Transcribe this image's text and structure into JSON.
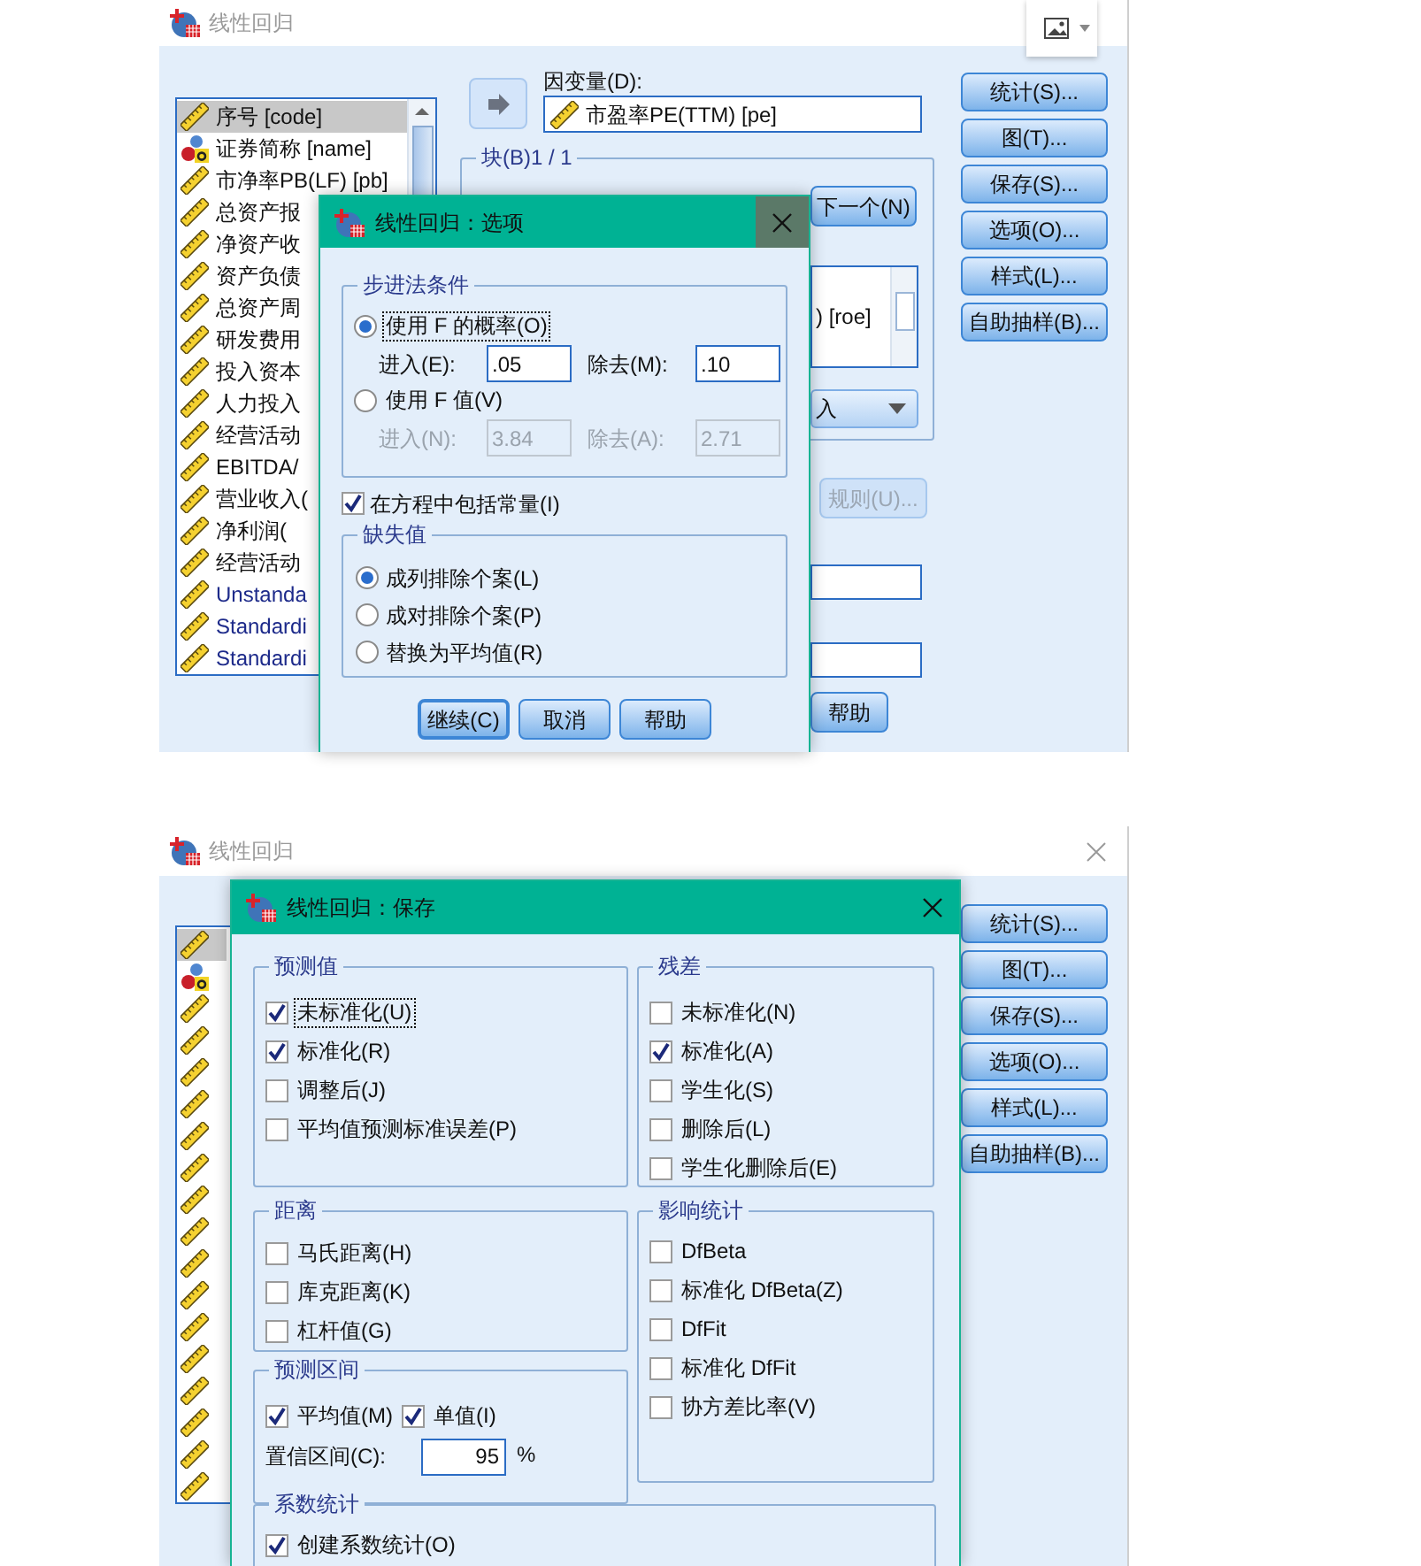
{
  "top_window": {
    "title": "线性回归",
    "variables": [
      {
        "label": "序号 [code]",
        "kind": "scale",
        "selected": true
      },
      {
        "label": "证券简称 [name]",
        "kind": "nominal",
        "selected": false
      },
      {
        "label": "市净率PB(LF) [pb]",
        "kind": "scale",
        "selected": false
      },
      {
        "label": "总资产报",
        "kind": "scale",
        "selected": false
      },
      {
        "label": "净资产收",
        "kind": "scale",
        "selected": false
      },
      {
        "label": "资产负债",
        "kind": "scale",
        "selected": false
      },
      {
        "label": "总资产周",
        "kind": "scale",
        "selected": false
      },
      {
        "label": "研发费用",
        "kind": "scale",
        "selected": false
      },
      {
        "label": "投入资本",
        "kind": "scale",
        "selected": false
      },
      {
        "label": "人力投入",
        "kind": "scale",
        "selected": false
      },
      {
        "label": "经营活动",
        "kind": "scale",
        "selected": false
      },
      {
        "label": "EBITDA/",
        "kind": "scale",
        "selected": false
      },
      {
        "label": "营业收入(",
        "kind": "scale",
        "selected": false
      },
      {
        "label": "净利润(",
        "kind": "scale",
        "selected": false
      },
      {
        "label": "经营活动",
        "kind": "scale",
        "selected": false
      },
      {
        "label": "Unstanda",
        "kind": "scale",
        "selected": false
      },
      {
        "label": "Standardi",
        "kind": "scale",
        "selected": false
      },
      {
        "label": "Standardi",
        "kind": "scale",
        "selected": false
      }
    ],
    "dependent": {
      "label": "因变量(D):",
      "value": "市盈率PE(TTM) [pe]"
    },
    "block": {
      "label": "块(B)1 / 1",
      "next_button": "下一个(N)",
      "list_item": ") [roe]",
      "method": "入"
    },
    "rule_button": {
      "label": "规则(U)...",
      "disabled": true
    },
    "help_button": "帮助",
    "side_buttons": [
      "统计(S)...",
      "图(T)...",
      "保存(S)...",
      "选项(O)...",
      "样式(L)...",
      "自助抽样(B)..."
    ]
  },
  "options_dialog": {
    "title": "线性回归：选项",
    "stepping": {
      "legend": "步进法条件",
      "methods": [
        {
          "label": "使用 F 的概率(O)",
          "selected": true,
          "focused": true,
          "fields": [
            {
              "label": "进入(E):",
              "value": ".05",
              "disabled": false
            },
            {
              "label": "除去(M):",
              "value": ".10",
              "disabled": false
            }
          ]
        },
        {
          "label": "使用 F 值(V)",
          "selected": false,
          "focused": false,
          "fields": [
            {
              "label": "进入(N):",
              "value": "3.84",
              "disabled": true
            },
            {
              "label": "除去(A):",
              "value": "2.71",
              "disabled": true
            }
          ]
        }
      ]
    },
    "include_constant": {
      "label": "在方程中包括常量(I)",
      "checked": true
    },
    "missing": {
      "legend": "缺失值",
      "options": [
        {
          "label": "成列排除个案(L)",
          "selected": true
        },
        {
          "label": "成对排除个案(P)",
          "selected": false
        },
        {
          "label": "替换为平均值(R)",
          "selected": false
        }
      ]
    },
    "buttons": [
      {
        "label": "继续(C)",
        "default": true
      },
      {
        "label": "取消",
        "default": false
      },
      {
        "label": "帮助",
        "default": false
      }
    ]
  },
  "bottom_window": {
    "title": "线性回归",
    "variables": [
      {
        "kind": "scale",
        "selected": true
      },
      {
        "kind": "nominal",
        "selected": false
      },
      {
        "kind": "scale",
        "selected": false
      },
      {
        "kind": "scale",
        "selected": false
      },
      {
        "kind": "scale",
        "selected": false
      },
      {
        "kind": "scale",
        "selected": false
      },
      {
        "kind": "scale",
        "selected": false
      },
      {
        "kind": "scale",
        "selected": false
      },
      {
        "kind": "scale",
        "selected": false
      },
      {
        "kind": "scale",
        "selected": false
      },
      {
        "kind": "scale",
        "selected": false
      },
      {
        "kind": "scale",
        "selected": false
      },
      {
        "kind": "scale",
        "selected": false
      },
      {
        "kind": "scale",
        "selected": false
      },
      {
        "kind": "scale",
        "selected": false
      },
      {
        "kind": "scale",
        "selected": false
      },
      {
        "kind": "scale",
        "selected": false
      },
      {
        "kind": "scale",
        "selected": false
      }
    ],
    "side_buttons": [
      "统计(S)...",
      "图(T)...",
      "保存(S)...",
      "选项(O)...",
      "样式(L)...",
      "自助抽样(B)..."
    ]
  },
  "save_dialog": {
    "title": "线性回归：保存",
    "predicted_values": {
      "legend": "预测值",
      "options": [
        {
          "label": "未标准化(U)",
          "checked": true,
          "focused": true
        },
        {
          "label": "标准化(R)",
          "checked": true,
          "focused": false
        },
        {
          "label": "调整后(J)",
          "checked": false,
          "focused": false
        },
        {
          "label": "平均值预测标准误差(P)",
          "checked": false,
          "focused": false
        }
      ]
    },
    "residuals": {
      "legend": "残差",
      "options": [
        {
          "label": "未标准化(N)",
          "checked": false,
          "focused": false
        },
        {
          "label": "标准化(A)",
          "checked": true,
          "focused": false
        },
        {
          "label": "学生化(S)",
          "checked": false,
          "focused": false
        },
        {
          "label": "删除后(L)",
          "checked": false,
          "focused": false
        },
        {
          "label": "学生化删除后(E)",
          "checked": false,
          "focused": false
        }
      ]
    },
    "distances": {
      "legend": "距离",
      "options": [
        {
          "label": "马氏距离(H)",
          "checked": false,
          "focused": false
        },
        {
          "label": "库克距离(K)",
          "checked": false,
          "focused": false
        },
        {
          "label": "杠杆值(G)",
          "checked": false,
          "focused": false
        }
      ]
    },
    "influence_statistics": {
      "legend": "影响统计",
      "options": [
        {
          "label": "DfBeta",
          "checked": false,
          "focused": false
        },
        {
          "label": "标准化 DfBeta(Z)",
          "checked": false,
          "focused": false
        },
        {
          "label": "DfFit",
          "checked": false,
          "focused": false
        },
        {
          "label": "标准化 DfFit",
          "checked": false,
          "focused": false
        },
        {
          "label": "协方差比率(V)",
          "checked": false,
          "focused": false
        }
      ]
    },
    "prediction_intervals": {
      "legend": "预测区间",
      "options": [
        {
          "label": "平均值(M)",
          "checked": true,
          "focused": false
        },
        {
          "label": "单值(I)",
          "checked": true,
          "focused": false
        }
      ],
      "confidence": {
        "label": "置信区间(C):",
        "value": "95",
        "unit": "%"
      }
    },
    "coefficient_statistics": {
      "legend": "系数统计",
      "options": [
        {
          "label": "创建系数统计(O)",
          "checked": true,
          "focused": false
        }
      ]
    }
  }
}
